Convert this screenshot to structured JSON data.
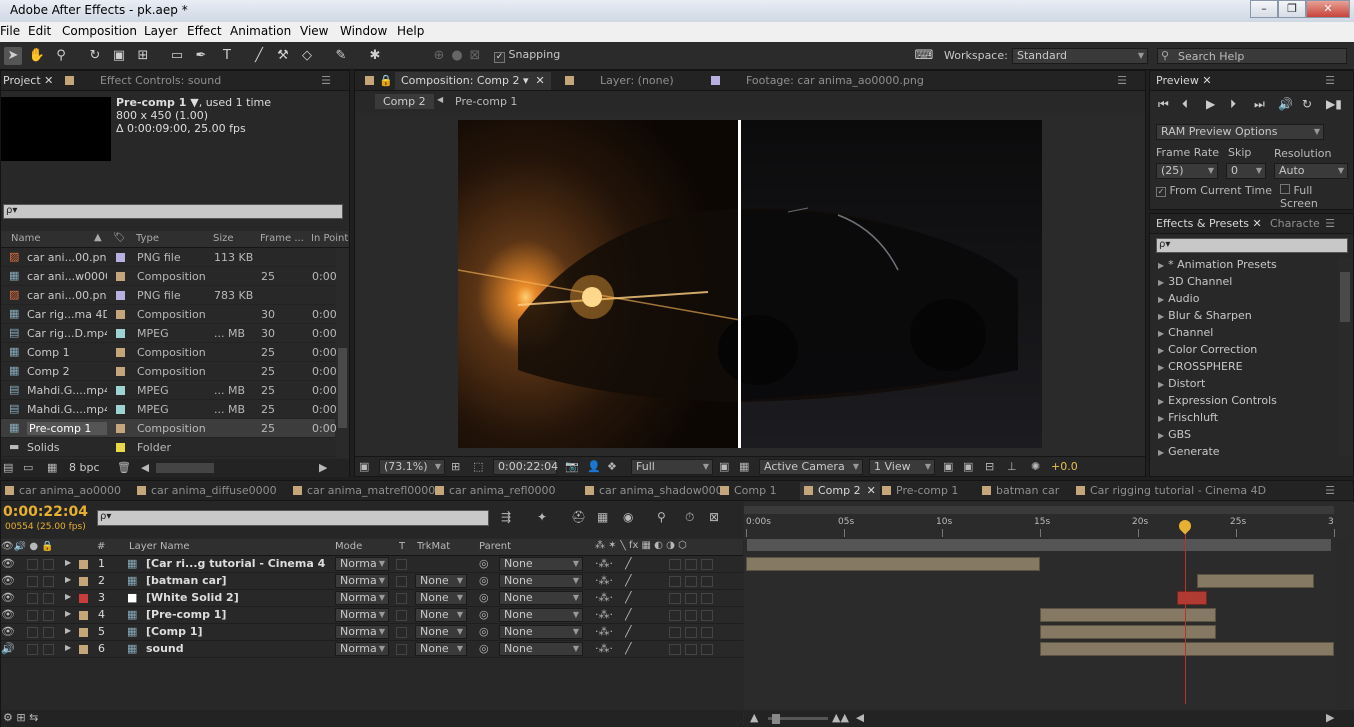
{
  "window": {
    "title": "Adobe After Effects - pk.aep *"
  },
  "menu": [
    "File",
    "Edit",
    "Composition",
    "Layer",
    "Effect",
    "Animation",
    "View",
    "Window",
    "Help"
  ],
  "toolbar": {
    "snapping": "Snapping",
    "workspace_label": "Workspace:",
    "workspace": "Standard",
    "search_placeholder": "Search Help"
  },
  "project": {
    "tab_project": "Project",
    "tab_effect": "Effect Controls: sound",
    "item_name": "Pre-comp 1 ▼",
    "item_used": ", used 1 time",
    "item_size": "800 x 450 (1.00)",
    "item_duration": "Δ 0:00:09:00, 25.00 fps",
    "search_placeholder": "ρ▾",
    "columns": {
      "name": "Name",
      "type": "Type",
      "size": "Size",
      "frame": "Frame ...",
      "inpoint": "In Point"
    },
    "items": [
      {
        "name": "car ani...00.png",
        "type": "PNG file",
        "size": "113 KB",
        "frame": "",
        "in": "",
        "color": "#b8b0e0",
        "icon": "png-icon"
      },
      {
        "name": "car ani...w0000",
        "type": "Composition",
        "size": "",
        "frame": "25",
        "in": "0:00",
        "color": "#c4a67a",
        "icon": "composition-icon"
      },
      {
        "name": "car ani...00.png",
        "type": "PNG file",
        "size": "783 KB",
        "frame": "",
        "in": "",
        "color": "#b8b0e0",
        "icon": "png-icon"
      },
      {
        "name": "Car rig...ma 4D",
        "type": "Composition",
        "size": "",
        "frame": "30",
        "in": "0:00",
        "color": "#c4a67a",
        "icon": "composition-icon"
      },
      {
        "name": "Car rig...D.mp4",
        "type": "MPEG",
        "size": "... MB",
        "frame": "30",
        "in": "0:00",
        "color": "#9fd2d2",
        "icon": "video-icon"
      },
      {
        "name": "Comp 1",
        "type": "Composition",
        "size": "",
        "frame": "25",
        "in": "0:00",
        "color": "#c4a67a",
        "icon": "composition-icon"
      },
      {
        "name": "Comp 2",
        "type": "Composition",
        "size": "",
        "frame": "25",
        "in": "0:00",
        "color": "#c4a67a",
        "icon": "composition-icon"
      },
      {
        "name": "Mahdi.G....mp4",
        "type": "MPEG",
        "size": "... MB",
        "frame": "25",
        "in": "0:00",
        "color": "#9fd2d2",
        "icon": "video-icon"
      },
      {
        "name": "Mahdi.G....mp4",
        "type": "MPEG",
        "size": "... MB",
        "frame": "25",
        "in": "0:00",
        "color": "#9fd2d2",
        "icon": "video-icon"
      },
      {
        "name": "Pre-comp 1",
        "type": "Composition",
        "size": "",
        "frame": "25",
        "in": "0:00",
        "color": "#c4a67a",
        "icon": "composition-icon",
        "selected": true
      },
      {
        "name": "Solids",
        "type": "Folder",
        "size": "",
        "frame": "",
        "in": "",
        "color": "#e8d84a",
        "icon": "folder-icon"
      }
    ],
    "bpc": "8 bpc"
  },
  "comp": {
    "tab_comp": "Composition: Comp 2",
    "tab_layer": "Layer: (none)",
    "tab_footage": "Footage: car anima_ao0000.png",
    "breadcrumb": [
      "Comp 2",
      "Pre-comp 1"
    ],
    "zoom": "(73.1%)",
    "time": "0:00:22:04",
    "resolution": "Full",
    "camera": "Active Camera",
    "views": "1 View",
    "exposure": "+0.0"
  },
  "preview": {
    "tab": "Preview",
    "ram": "RAM Preview Options",
    "frame_rate_label": "Frame Rate",
    "skip_label": "Skip",
    "resolution_label": "Resolution",
    "frame_rate": "(25)",
    "skip": "0",
    "resolution": "Auto",
    "from_current": "From Current Time",
    "full_screen": "Full Screen"
  },
  "effects": {
    "tab": "Effects & Presets",
    "tab2": "Characte",
    "search": "ρ▾",
    "items": [
      "* Animation Presets",
      "3D Channel",
      "Audio",
      "Blur & Sharpen",
      "Channel",
      "Color Correction",
      "CROSSPHERE",
      "Distort",
      "Expression Controls",
      "Frischluft",
      "GBS",
      "Generate"
    ]
  },
  "timeline": {
    "tabs": [
      "car anima_ao0000",
      "car anima_diffuse0000",
      "car anima_matrefl0000",
      "car anima_refl0000",
      "car anima_shadow0000",
      "Comp 1",
      "Comp 2",
      "Pre-comp 1",
      "batman car",
      "Car rigging tutorial - Cinema 4D"
    ],
    "active_tab": 6,
    "time": "0:00:22:04",
    "frame": "00554 (25.00 fps)",
    "search": "ρ▾",
    "headers": {
      "num": "#",
      "layer": "Layer Name",
      "mode": "Mode",
      "t": "T",
      "trkmat": "TrkMat",
      "parent": "Parent"
    },
    "ruler": [
      "0:00s",
      "05s",
      "10s",
      "15s",
      "20s",
      "25s",
      "3"
    ],
    "layers": [
      {
        "num": "1",
        "name": "[Car ri...g tutorial - Cinema 4D]",
        "mode": "Norma",
        "trk": "",
        "parent": "None",
        "color": "#c4a67a",
        "icon": "composition-icon",
        "bar_start_s": 0,
        "bar_end_s": 15
      },
      {
        "num": "2",
        "name": "[batman car]",
        "mode": "Norma",
        "trk": "None",
        "parent": "None",
        "color": "#c4a67a",
        "icon": "composition-icon",
        "bar_start_s": 23,
        "bar_end_s": 29
      },
      {
        "num": "3",
        "name": "[White Solid 2]",
        "mode": "Norma",
        "trk": "None",
        "parent": "None",
        "color": "#c83c3c",
        "icon": "solid-icon",
        "bar_start_s": 22,
        "bar_end_s": 23.5
      },
      {
        "num": "4",
        "name": "[Pre-comp 1]",
        "mode": "Norma",
        "trk": "None",
        "parent": "None",
        "color": "#c4a67a",
        "icon": "composition-icon",
        "bar_start_s": 15,
        "bar_end_s": 24
      },
      {
        "num": "5",
        "name": "[Comp 1]",
        "mode": "Norma",
        "trk": "None",
        "parent": "None",
        "color": "#c4a67a",
        "icon": "composition-icon",
        "bar_start_s": 15,
        "bar_end_s": 24
      },
      {
        "num": "6",
        "name": "sound",
        "mode": "Norma",
        "trk": "None",
        "parent": "None",
        "color": "#c4a67a",
        "icon": "composition-icon",
        "bar_start_s": 15,
        "bar_end_s": 30
      }
    ]
  }
}
